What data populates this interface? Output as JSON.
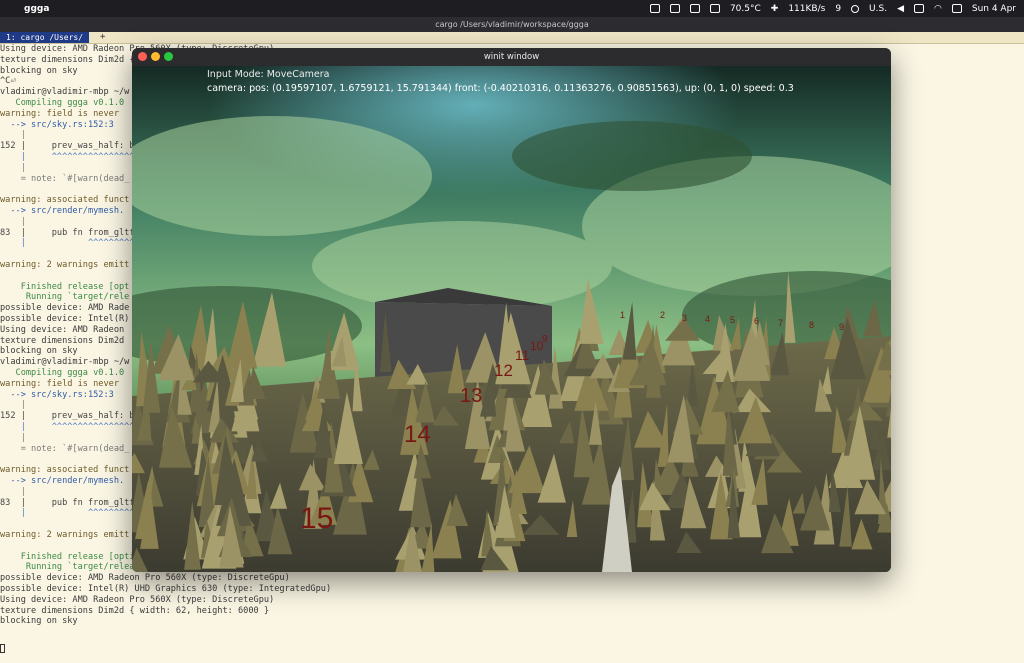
{
  "menubar": {
    "apple_icon": "apple-logo",
    "app_name": "ggga",
    "temperature": "70.5°C",
    "network": "111KB/s",
    "counter": "9",
    "input_source": "U.S.",
    "datetime": "Sun 4 Apr"
  },
  "terminal": {
    "window_title": "cargo /Users/vladimir/workspace/ggga",
    "tab_label": "1: cargo /Users/",
    "tab_add": "+",
    "lines": [
      {
        "text": "Using device: AMD Radeon Pro 560X (type: DiscreteGpu)",
        "cls": ""
      },
      {
        "text": "texture dimensions Dim2d { width: 62, height: 6000 }",
        "cls": ""
      },
      {
        "text": "blocking on sky",
        "cls": ""
      },
      {
        "text": "^C⏎",
        "cls": ""
      },
      {
        "text": "vladimir@vladimir-mbp ~/w",
        "cls": ""
      },
      {
        "text": "   Compiling ggga v0.1.0",
        "cls": "t-green"
      },
      {
        "text": "warning: field is never",
        "cls": "t-warn"
      },
      {
        "text": "  --> src/sky.rs:152:3",
        "cls": "t-arrow"
      },
      {
        "text": "    |",
        "cls": "t-num"
      },
      {
        "text": "152 |     prev_was_half: bo",
        "cls": "t-code"
      },
      {
        "text": "    |     ^^^^^^^^^^^^^^^^^",
        "cls": "t-caret"
      },
      {
        "text": "    |",
        "cls": "t-num"
      },
      {
        "text": "    = note: `#[warn(dead_",
        "cls": "t-num"
      },
      {
        "text": "",
        "cls": ""
      },
      {
        "text": "warning: associated funct",
        "cls": "t-warn"
      },
      {
        "text": "  --> src/render/mymesh.",
        "cls": "t-arrow"
      },
      {
        "text": "    |",
        "cls": "t-num"
      },
      {
        "text": "83  |     pub fn from_gltf(p",
        "cls": "t-code"
      },
      {
        "text": "    |            ^^^^^^^^^",
        "cls": "t-caret"
      },
      {
        "text": "",
        "cls": ""
      },
      {
        "text": "warning: 2 warnings emitt",
        "cls": "t-warn"
      },
      {
        "text": "",
        "cls": ""
      },
      {
        "text": "    Finished release [opt",
        "cls": "t-green"
      },
      {
        "text": "     Running `target/rele",
        "cls": "t-green"
      },
      {
        "text": "possible device: AMD Rade",
        "cls": ""
      },
      {
        "text": "possible device: Intel(R)",
        "cls": ""
      },
      {
        "text": "Using device: AMD Radeon",
        "cls": ""
      },
      {
        "text": "texture dimensions Dim2d",
        "cls": ""
      },
      {
        "text": "blocking on sky",
        "cls": ""
      },
      {
        "text": "vladimir@vladimir-mbp ~/w",
        "cls": ""
      },
      {
        "text": "   Compiling ggga v0.1.0",
        "cls": "t-green"
      },
      {
        "text": "warning: field is never",
        "cls": "t-warn"
      },
      {
        "text": "  --> src/sky.rs:152:3",
        "cls": "t-arrow"
      },
      {
        "text": "    |",
        "cls": "t-num"
      },
      {
        "text": "152 |     prev_was_half: bo",
        "cls": "t-code"
      },
      {
        "text": "    |     ^^^^^^^^^^^^^^^^^",
        "cls": "t-caret"
      },
      {
        "text": "    |",
        "cls": "t-num"
      },
      {
        "text": "    = note: `#[warn(dead_",
        "cls": "t-num"
      },
      {
        "text": "",
        "cls": ""
      },
      {
        "text": "warning: associated funct",
        "cls": "t-warn"
      },
      {
        "text": "  --> src/render/mymesh.",
        "cls": "t-arrow"
      },
      {
        "text": "    |",
        "cls": "t-num"
      },
      {
        "text": "83  |     pub fn from_gltf(p",
        "cls": "t-code"
      },
      {
        "text": "    |            ^^^^^^^^^",
        "cls": "t-caret"
      },
      {
        "text": "",
        "cls": ""
      },
      {
        "text": "warning: 2 warnings emitt",
        "cls": "t-warn"
      },
      {
        "text": "",
        "cls": ""
      },
      {
        "text": "    Finished release [optimized] target(s) in 13.85s",
        "cls": "t-green"
      },
      {
        "text": "     Running `target/release/ggga`",
        "cls": "t-green"
      },
      {
        "text": "possible device: AMD Radeon Pro 560X (type: DiscreteGpu)",
        "cls": ""
      },
      {
        "text": "possible device: Intel(R) UHD Graphics 630 (type: IntegratedGpu)",
        "cls": ""
      },
      {
        "text": "Using device: AMD Radeon Pro 560X (type: DiscreteGpu)",
        "cls": ""
      },
      {
        "text": "texture dimensions Dim2d { width: 62, height: 6000 }",
        "cls": ""
      },
      {
        "text": "blocking on sky",
        "cls": ""
      }
    ]
  },
  "winit": {
    "window_title": "winit window",
    "hud_mode": "Input Mode: MoveCamera",
    "hud_camera": "camera: pos: (0.19597107, 1.6759121, 15.791344) front: (-0.40210316, 0.11363276, 0.90851563), up: (0, 1, 0) speed: 0.3",
    "scene_labels": [
      {
        "text": "15",
        "name": "depth-label-15"
      },
      {
        "text": "14",
        "name": "depth-label-14"
      },
      {
        "text": "13",
        "name": "depth-label-13"
      },
      {
        "text": "12",
        "name": "depth-label-12"
      },
      {
        "text": "11",
        "name": "depth-label-11"
      },
      {
        "text": "10",
        "name": "depth-label-10"
      },
      {
        "text": "9",
        "name": "depth-label-9"
      },
      {
        "text": "1",
        "name": "axis-label-1"
      },
      {
        "text": "2",
        "name": "axis-label-2"
      },
      {
        "text": "3",
        "name": "axis-label-3"
      },
      {
        "text": "4",
        "name": "axis-label-4"
      },
      {
        "text": "5",
        "name": "axis-label-5"
      },
      {
        "text": "6",
        "name": "axis-label-6"
      },
      {
        "text": "7",
        "name": "axis-label-7"
      },
      {
        "text": "8",
        "name": "axis-label-8"
      },
      {
        "text": "9",
        "name": "axis-label-9b"
      }
    ],
    "colors": {
      "sky_top": "#1f3a2c",
      "sky_cloud": "#6fae6a",
      "terrain": "#7d7548",
      "label_red": "#7a1712",
      "box": "#464646"
    }
  }
}
